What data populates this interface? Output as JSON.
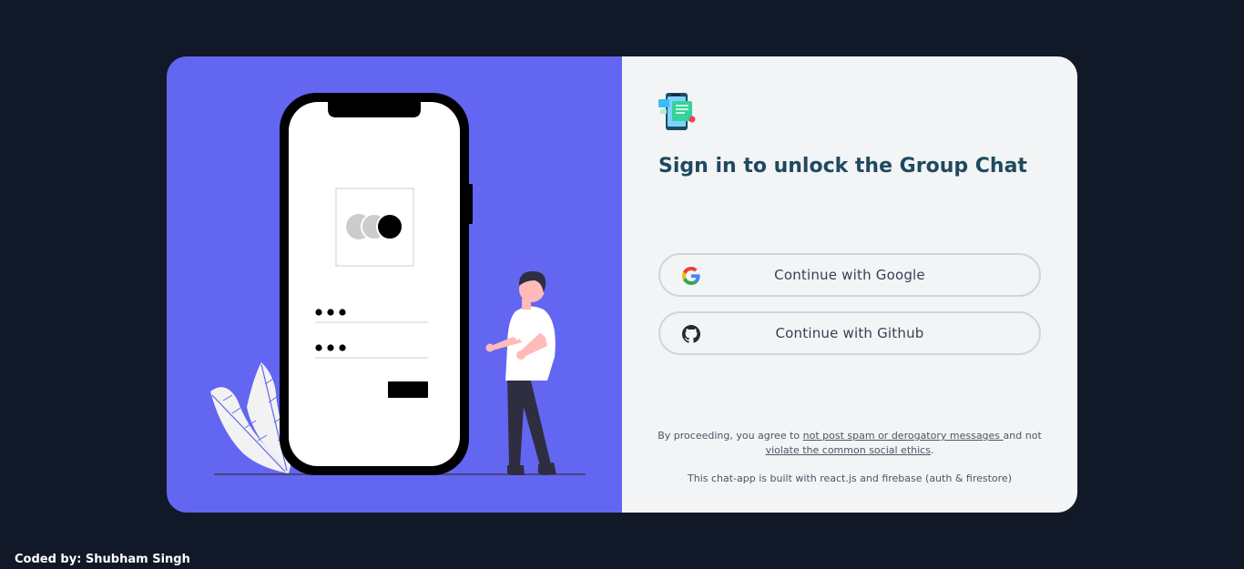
{
  "login": {
    "title": "Sign in to unlock the Group Chat",
    "google_button": "Continue with Google",
    "github_button": "Continue with Github",
    "terms_prefix": "By proceeding, you agree to ",
    "terms_link1": "not post spam or derogatory messages ",
    "terms_mid": "and not ",
    "terms_link2": "violate the common social ethics",
    "terms_suffix": ".",
    "built_with": "This chat-app is built with react.js and firebase (auth & firestore)"
  },
  "footer": {
    "credit": "Coded by: Shubham Singh"
  },
  "icons": {
    "app_logo": "chat-app-logo-icon",
    "google": "google-icon",
    "github": "github-icon"
  },
  "colors": {
    "page_background": "#111827",
    "illustration_panel": "#6366f1",
    "form_panel": "#f3f4f6",
    "title_text": "#1e4a5f"
  }
}
